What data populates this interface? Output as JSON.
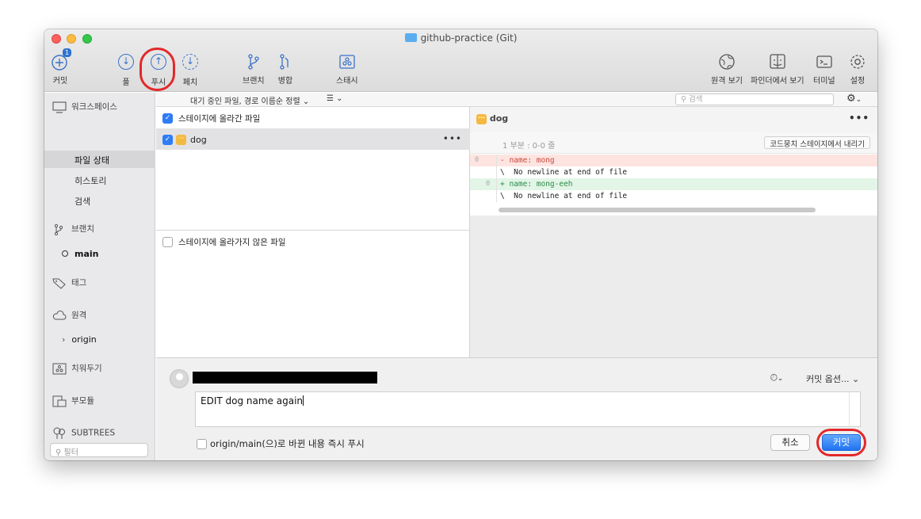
{
  "window": {
    "title": "github-practice (Git)"
  },
  "toolbar": {
    "commit_label": "커밋",
    "commit_badge": "1",
    "pull_label": "풀",
    "push_label": "푸시",
    "fetch_label": "페치",
    "branch_label": "브랜치",
    "merge_label": "병합",
    "stash_label": "스태시",
    "remote_view_label": "원격 보기",
    "finder_label": "파인더에서 보기",
    "terminal_label": "터미널",
    "settings_label": "설정"
  },
  "sidebar": {
    "workspace": "워크스페이스",
    "file_status": "파일 상태",
    "history": "히스토리",
    "search": "검색",
    "branches": "브랜치",
    "branch_main": "main",
    "tags": "태그",
    "remotes": "원격",
    "remote_origin": "origin",
    "stashes": "치워두기",
    "submodules": "부모듈",
    "subtrees": "SUBTREES",
    "filter_placeholder": "필터"
  },
  "filterbar": {
    "sort_label": "대기 중인 파일, 경로 이름순 정렬",
    "search_placeholder": "검색"
  },
  "staged": {
    "header": "스테이지에 올라간 파일",
    "files": [
      {
        "name": "dog"
      }
    ]
  },
  "unstaged": {
    "header": "스테이지에 올라가지 않은 파일"
  },
  "diff": {
    "file": "dog",
    "hunk_title": "1 부분 : 0-0 줄",
    "hunk_button": "코드뭉치 스테이지에서 내리기",
    "lines": [
      {
        "old": "0",
        "new": "",
        "text": "- name: mong"
      },
      {
        "old": "",
        "new": "",
        "text": "\\  No newline at end of file"
      },
      {
        "old": "",
        "new": "0",
        "text": "+ name: mong-eeh"
      },
      {
        "old": "",
        "new": "",
        "text": "\\  No newline at end of file"
      }
    ]
  },
  "commit": {
    "message": "EDIT dog name again",
    "options_label": "커밋 옵션...",
    "push_now_label": "origin/main(으)로 바뀐 내용 즉시 푸시",
    "push_now_checked": false,
    "cancel_label": "취소",
    "commit_label": "커밋"
  },
  "colors": {
    "accent": "#2e7cf6",
    "highlight": "#e3282a"
  }
}
